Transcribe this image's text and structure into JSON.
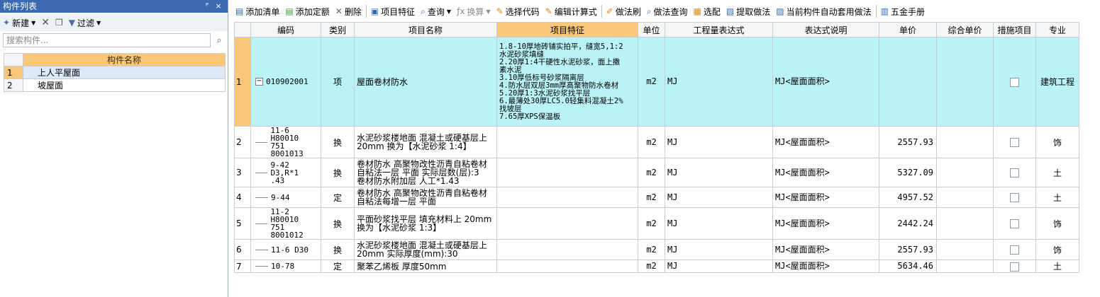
{
  "left_panel": {
    "title": "构件列表",
    "pin_glyph": "ᴾ",
    "close_glyph": "×",
    "toolbar": {
      "new_label": "新建",
      "filter_label": "过滤"
    },
    "search": {
      "placeholder": "搜索构件..."
    },
    "table": {
      "header": "构件名称",
      "rows": [
        {
          "index": "1",
          "name": "上人平屋面"
        },
        {
          "index": "2",
          "name": "坡屋面"
        }
      ]
    }
  },
  "toolbar": {
    "items": [
      {
        "label": "添加清单",
        "icon": "add-list-icon"
      },
      {
        "label": "添加定额",
        "icon": "add-quota-icon"
      },
      {
        "label": "删除",
        "icon": "delete-icon"
      },
      {
        "label": "项目特征",
        "icon": "item-feature-icon"
      },
      {
        "label": "查询",
        "icon": "query-icon"
      },
      {
        "label": "换算",
        "icon": "convert-icon"
      },
      {
        "label": "选择代码",
        "icon": "select-code-icon"
      },
      {
        "label": "编辑计算式",
        "icon": "edit-formula-icon"
      },
      {
        "label": "做法刷",
        "icon": "method-brush-icon"
      },
      {
        "label": "做法查询",
        "icon": "method-query-icon"
      },
      {
        "label": "选配",
        "icon": "match-icon"
      },
      {
        "label": "提取做法",
        "icon": "extract-method-icon"
      },
      {
        "label": "当前构件自动套用做法",
        "icon": "auto-apply-icon"
      },
      {
        "label": "五金手册",
        "icon": "hardware-manual-icon"
      }
    ]
  },
  "grid": {
    "headers": {
      "code": "编码",
      "type": "类别",
      "name": "项目名称",
      "feature": "项目特征",
      "unit": "单位",
      "expr": "工程量表达式",
      "expr_desc": "表达式说明",
      "price": "单价",
      "total_price": "综合单价",
      "measure": "措施项目",
      "major": "专业"
    },
    "rows": [
      {
        "no": "1",
        "code": "010902001",
        "type": "项",
        "name": "屋面卷材防水",
        "feature": "1.8-10厚地砖铺实拍平，缝宽5,1:2\n水泥砂浆填缝\n2.20厚1:4干硬性水泥砂浆，面上撒\n素水泥\n3.10厚低标号砂浆隔离层\n4.防水层双层3mm厚高聚物防水卷材\n5.20厚1:3水泥砂浆找平层\n6.最薄处30厚LC5.0轻集料混凝土2%\n找坡层\n7.65厚XPS保温板",
        "unit": "m2",
        "expr": "MJ",
        "expr_desc": "MJ<屋面面积>",
        "price": "",
        "total_price": "",
        "major": "建筑工程"
      },
      {
        "no": "2",
        "code": "11-6 H80010\n751 8001013",
        "type": "换",
        "name": "水泥砂浆楼地面 混凝土或硬基层上\n20mm 换为【水泥砂浆 1:4】",
        "feature": "",
        "unit": "m2",
        "expr": "MJ",
        "expr_desc": "MJ<屋面面积>",
        "price": "2557.93",
        "total_price": "",
        "major": "饰"
      },
      {
        "no": "3",
        "code": "9-42 D3,R*1\n.43",
        "type": "换",
        "name": "卷材防水 高聚物改性沥青自粘卷材\n自粘法一层 平面 实际层数(层):3\n卷材防水附加层 人工*1.43",
        "feature": "",
        "unit": "m2",
        "expr": "MJ",
        "expr_desc": "MJ<屋面面积>",
        "price": "5327.09",
        "total_price": "",
        "major": "土"
      },
      {
        "no": "4",
        "code": "9-44",
        "type": "定",
        "name": "卷材防水 高聚物改性沥青自粘卷材\n自粘法每增一层 平面",
        "feature": "",
        "unit": "m2",
        "expr": "MJ",
        "expr_desc": "MJ<屋面面积>",
        "price": "4957.52",
        "total_price": "",
        "major": "土"
      },
      {
        "no": "5",
        "code": "11-2 H80010\n751 8001012",
        "type": "换",
        "name": "平面砂浆找平层 填充材料上 20mm\n换为【水泥砂浆 1:3】",
        "feature": "",
        "unit": "m2",
        "expr": "MJ",
        "expr_desc": "MJ<屋面面积>",
        "price": "2442.24",
        "total_price": "",
        "major": "饰"
      },
      {
        "no": "6",
        "code": "11-6 D30",
        "type": "换",
        "name": "水泥砂浆楼地面 混凝土或硬基层上\n20mm 实际厚度(mm):30",
        "feature": "",
        "unit": "m2",
        "expr": "MJ",
        "expr_desc": "MJ<屋面面积>",
        "price": "2557.93",
        "total_price": "",
        "major": "饰"
      },
      {
        "no": "7",
        "code": "10-78",
        "type": "定",
        "name": "聚苯乙烯板 厚度50mm",
        "feature": "",
        "unit": "m2",
        "expr": "MJ",
        "expr_desc": "MJ<屋面面积>",
        "price": "5634.46",
        "total_price": "",
        "major": "土"
      }
    ]
  }
}
